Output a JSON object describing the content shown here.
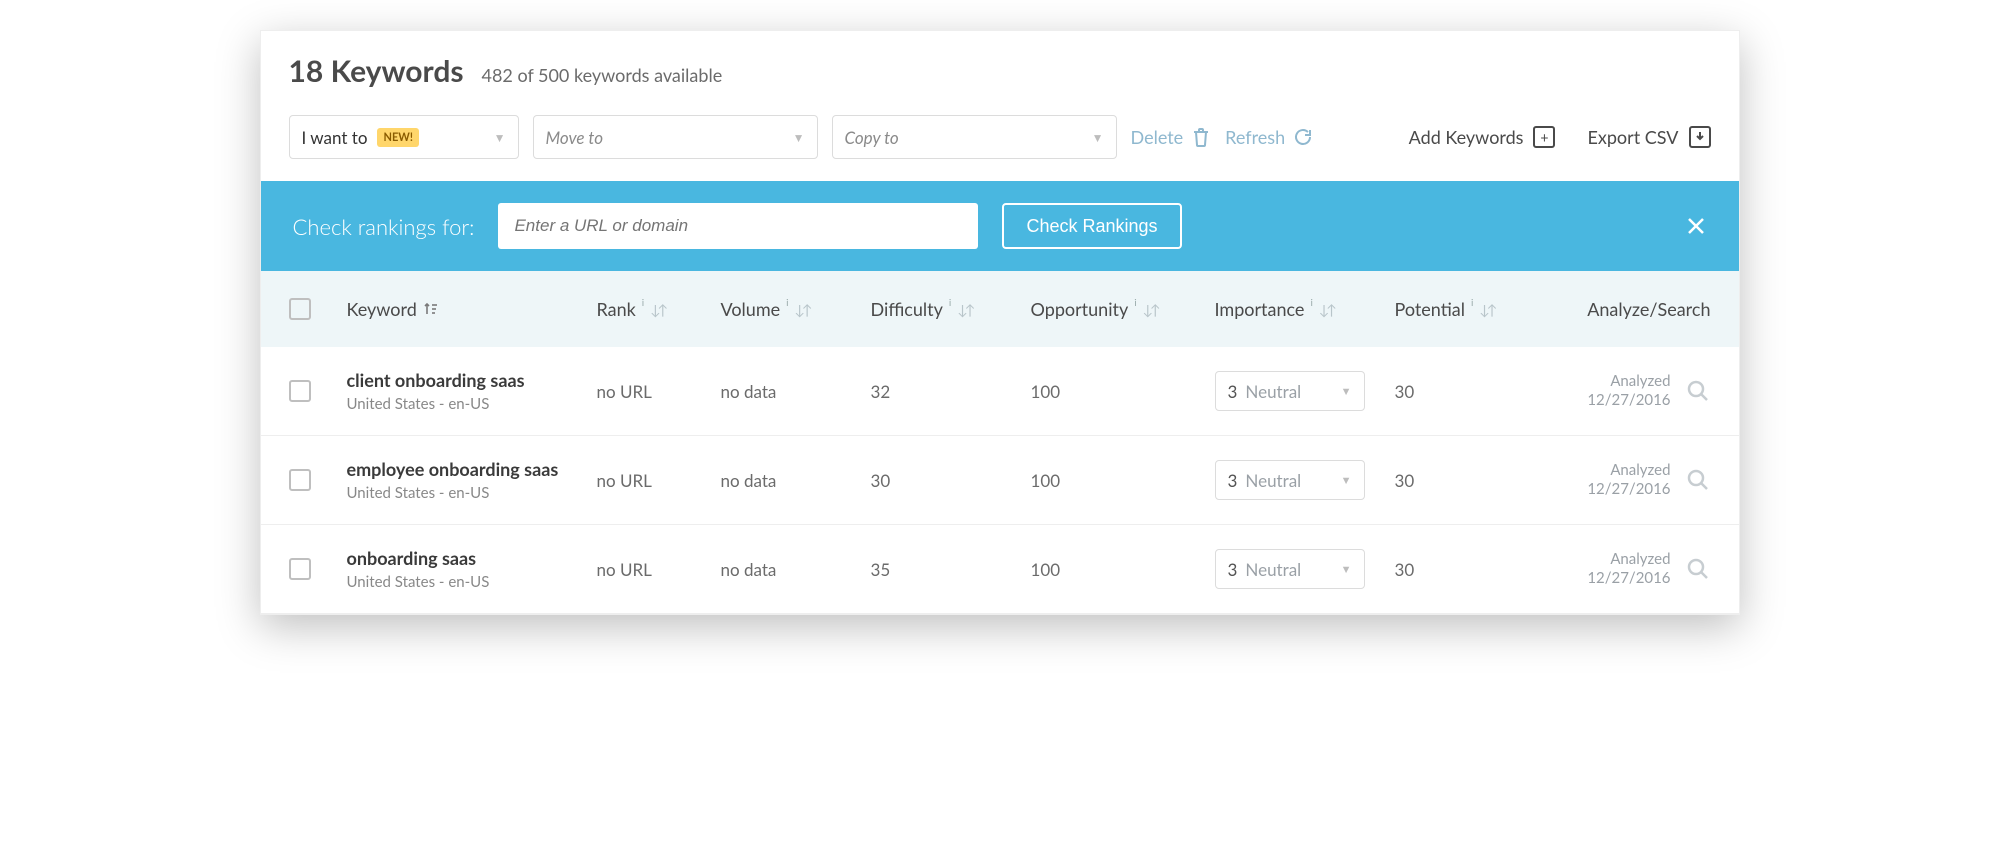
{
  "header": {
    "title_count": "18",
    "title_word": "Keywords",
    "subtitle": "482 of 500 keywords available"
  },
  "toolbar": {
    "i_want_to": "I want to",
    "new_badge": "NEW!",
    "move_to": "Move to",
    "copy_to": "Copy to",
    "delete": "Delete",
    "refresh": "Refresh",
    "add_keywords": "Add Keywords",
    "export_csv": "Export CSV"
  },
  "banner": {
    "label": "Check rankings for:",
    "placeholder": "Enter a URL or domain",
    "button": "Check Rankings"
  },
  "columns": {
    "keyword": "Keyword",
    "rank": "Rank",
    "volume": "Volume",
    "difficulty": "Difficulty",
    "opportunity": "Opportunity",
    "importance": "Importance",
    "potential": "Potential",
    "analyze": "Analyze/Search"
  },
  "importance_option": {
    "value": "3",
    "label": "Neutral"
  },
  "rows": [
    {
      "keyword": "client onboarding saas",
      "locale": "United States - en-US",
      "rank": "no URL",
      "volume": "no data",
      "difficulty": "32",
      "opportunity": "100",
      "potential": "30",
      "analyzed_label": "Analyzed",
      "analyzed_date": "12/27/2016"
    },
    {
      "keyword": "employee onboarding saas",
      "locale": "United States - en-US",
      "rank": "no URL",
      "volume": "no data",
      "difficulty": "30",
      "opportunity": "100",
      "potential": "30",
      "analyzed_label": "Analyzed",
      "analyzed_date": "12/27/2016"
    },
    {
      "keyword": "onboarding saas",
      "locale": "United States - en-US",
      "rank": "no URL",
      "volume": "no data",
      "difficulty": "35",
      "opportunity": "100",
      "potential": "30",
      "analyzed_label": "Analyzed",
      "analyzed_date": "12/27/2016"
    }
  ]
}
